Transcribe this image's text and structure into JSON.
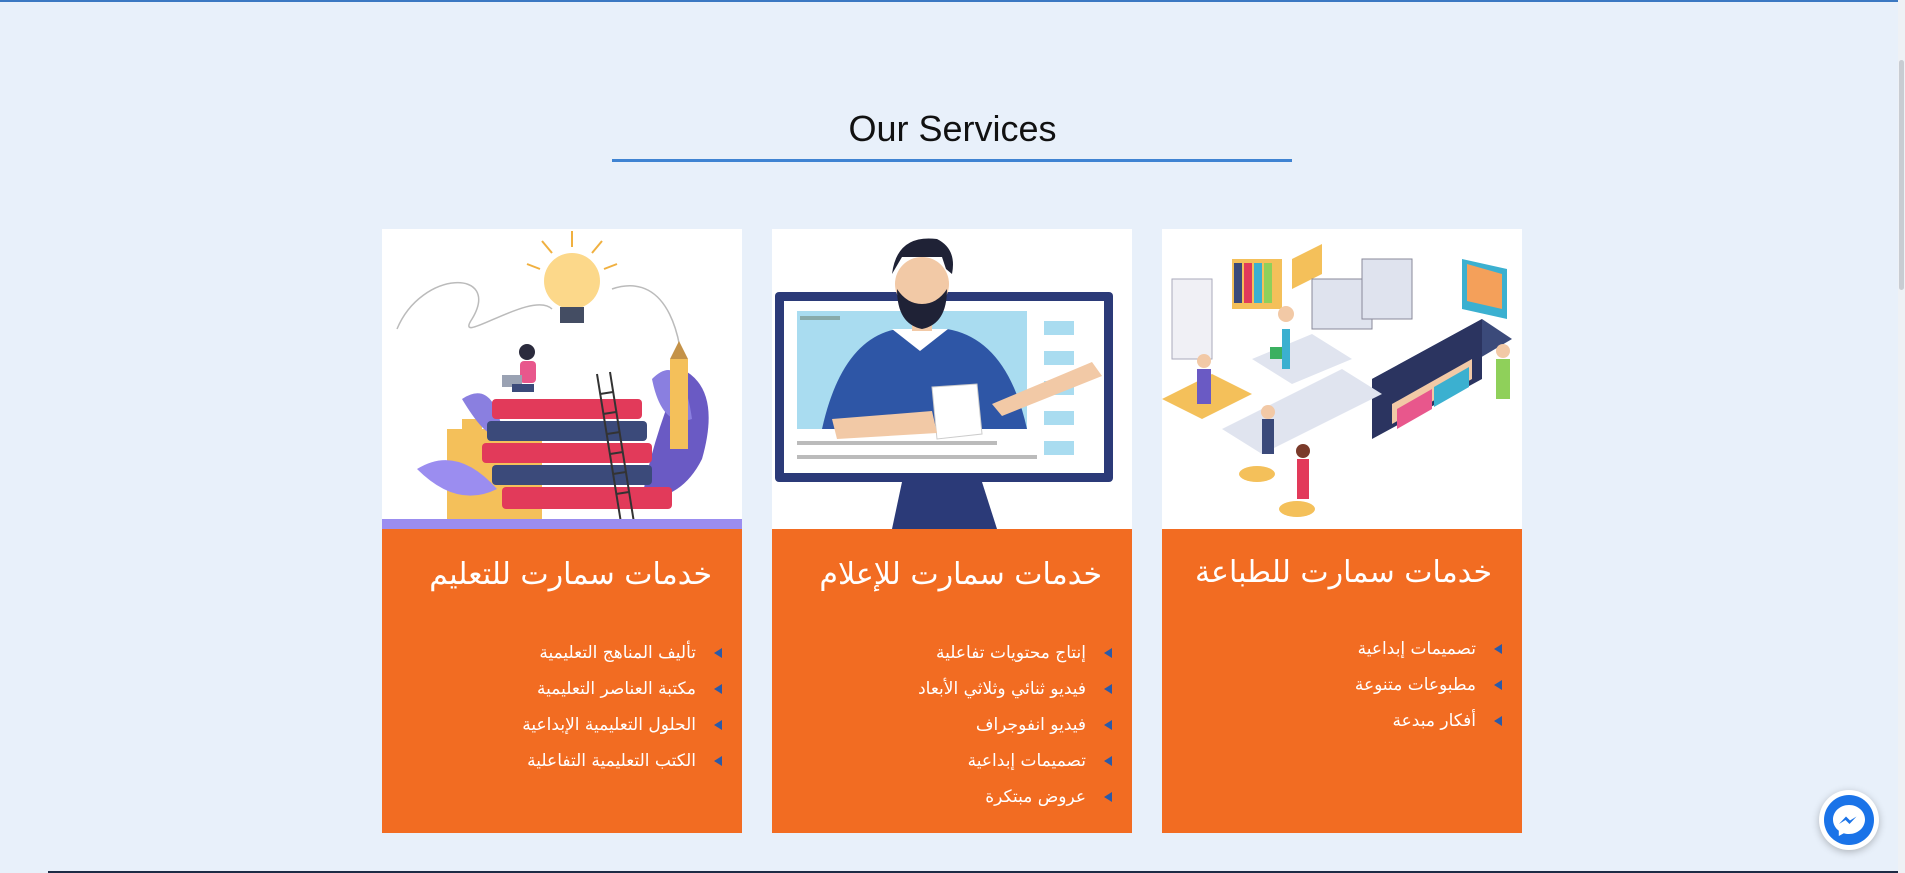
{
  "page": {
    "section_title": "Our Services"
  },
  "services": [
    {
      "title": "خدمات سمارت للتعليم",
      "illustration_icon": "books-lightbulb-icon",
      "items": [
        "تأليف المناهج التعليمية",
        "مكتبة العناصر التعليمية",
        "الحلول التعليمية الإبداعية",
        "الكتب التعليمية التفاعلية"
      ]
    },
    {
      "title": "خدمات سمارت للإعلام",
      "illustration_icon": "presenter-monitor-icon",
      "items": [
        "إنتاج محتويات تفاعلية",
        "فيديو ثنائي وثلاثي الأبعاد",
        "فيديو انفوجراف",
        "تصميمات إبداعية",
        "عروض مبتكرة"
      ]
    },
    {
      "title": "خدمات سمارت للطباعة",
      "illustration_icon": "printing-office-icon",
      "items": [
        "تصميمات إبداعية",
        "مطبوعات متنوعة",
        "أفكار مبدعة"
      ]
    }
  ],
  "colors": {
    "background": "#e8f0fa",
    "card": "#f26c22",
    "accent": "#3f83d2",
    "bullet": "#2b5aa8"
  },
  "widgets": {
    "chat_icon": "messenger-icon"
  }
}
